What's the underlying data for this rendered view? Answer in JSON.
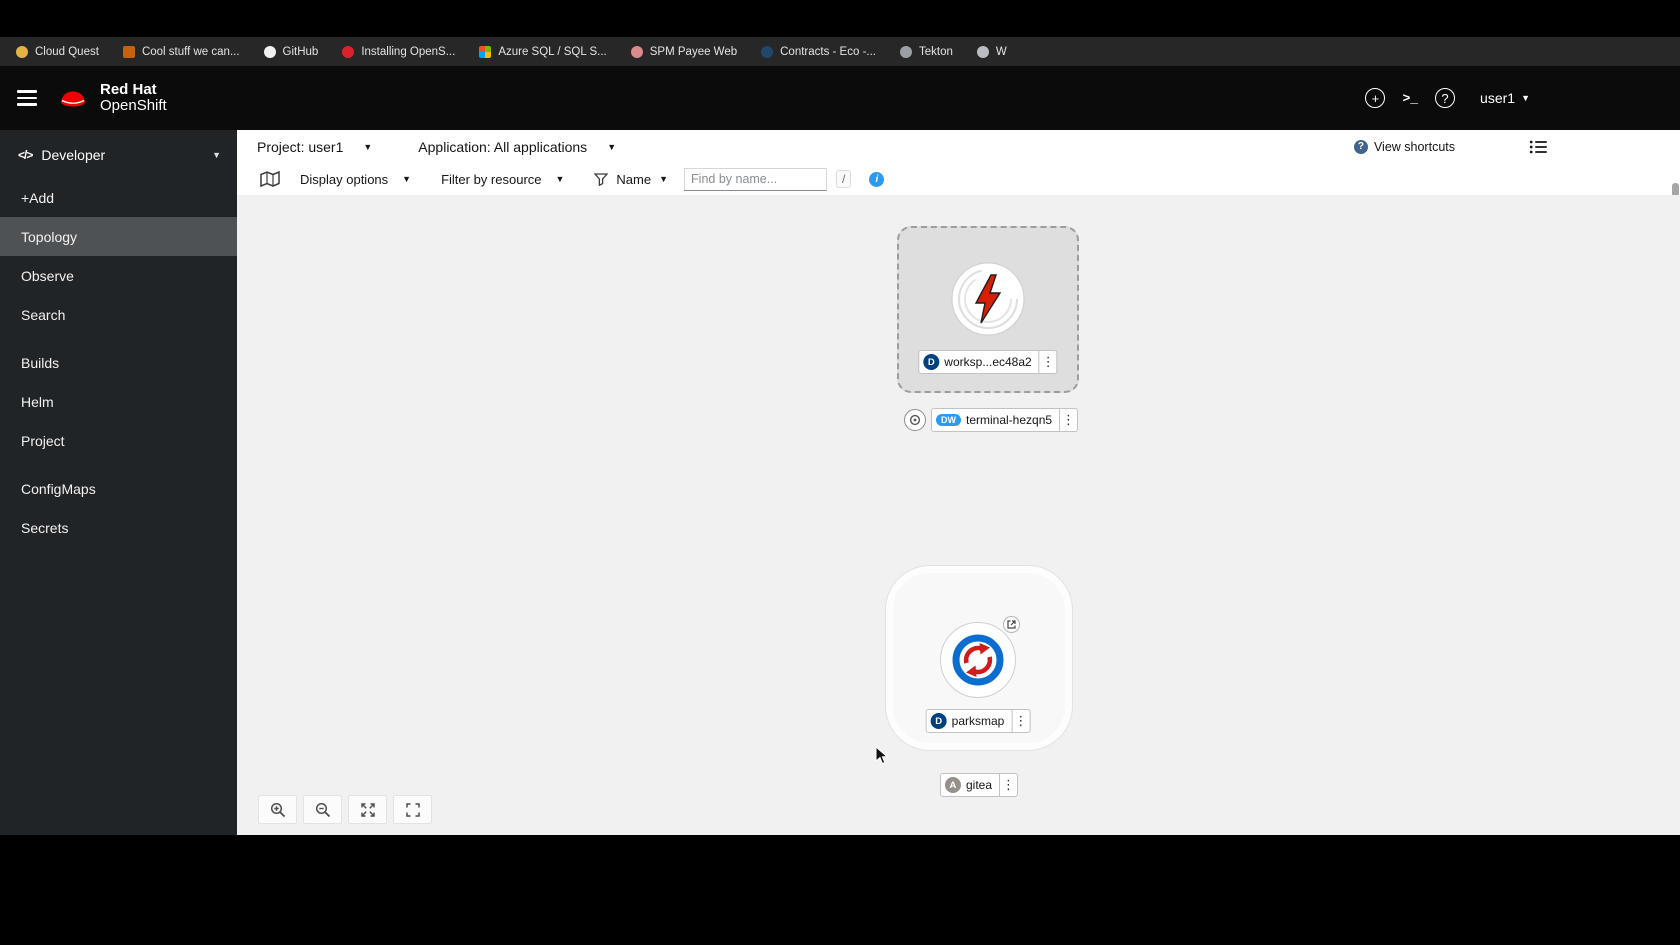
{
  "colors": {
    "brand_red": "#ee0000",
    "masthead_bg": "#0b0b0b",
    "sidebar_bg": "#212427",
    "sidebar_active": "#4f5255",
    "canvas_bg": "#f1f1f1",
    "info_blue": "#2b9af3",
    "badge_deployment": "#004080",
    "badge_devworkspace": "#2b9af3",
    "badge_application": "#95918a"
  },
  "bookmarks_bar": {
    "items": [
      {
        "label": "Cloud Quest",
        "icon_style": "background:#e3b341"
      },
      {
        "label": "Cool stuff we can...",
        "icon_style": "background:#c46210;border-radius:2px"
      },
      {
        "label": "GitHub",
        "icon_style": "background:#f0f0f0"
      },
      {
        "label": "Installing OpenS...",
        "icon_style": "background:#db212e"
      },
      {
        "label": "Azure SQL / SQL S...",
        "icon_style": "background:conic-gradient(#7fba00 0 25%,#ffb900 0 50%,#00a4ef 0 75%,#f25022 0);border-radius:2px"
      },
      {
        "label": "SPM Payee Web",
        "icon_style": "background:#d98c8c"
      },
      {
        "label": "Contracts - Eco -...",
        "icon_style": "background:#23476b"
      },
      {
        "label": "Tekton",
        "icon_style": "background:#9aa0a6"
      },
      {
        "label": "W",
        "icon_style": "background:#b9bdc2"
      }
    ]
  },
  "masthead": {
    "brand_line1": "Red Hat",
    "brand_line2": "OpenShift",
    "username": "user1"
  },
  "sidebar": {
    "perspective": "Developer",
    "items": [
      {
        "label": "+Add"
      },
      {
        "label": "Topology"
      },
      {
        "label": "Observe"
      },
      {
        "label": "Search"
      },
      {
        "label": "Builds"
      },
      {
        "label": "Helm"
      },
      {
        "label": "Project"
      },
      {
        "label": "ConfigMaps"
      },
      {
        "label": "Secrets"
      }
    ]
  },
  "context_bar": {
    "project": "Project: user1",
    "application": "Application: All applications",
    "view_shortcuts_label": "View shortcuts"
  },
  "toolbar": {
    "display_options_label": "Display options",
    "filter_by_resource_label": "Filter by resource",
    "name_filter_label": "Name",
    "find_placeholder": "Find by name...",
    "shortcut_key": "/"
  },
  "topology": {
    "workspace_node": {
      "badge": "D",
      "label": "worksp...ec48a2"
    },
    "terminal_node": {
      "badge": "DW",
      "label": "terminal-hezqn5"
    },
    "parksmap_node": {
      "badge": "D",
      "label": "parksmap"
    },
    "gitea_node": {
      "badge": "A",
      "label": "gitea"
    }
  }
}
